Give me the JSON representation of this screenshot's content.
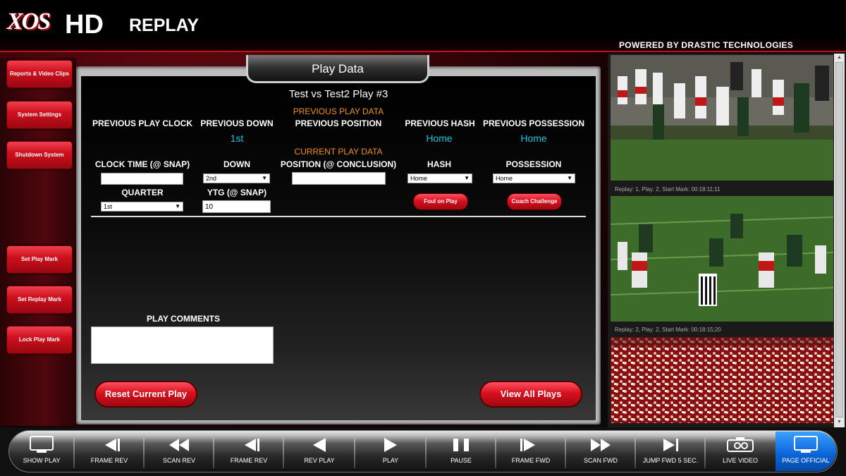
{
  "header": {
    "logo_xos": "XOS",
    "logo_hd": "HD",
    "logo_replay": "REPLAY",
    "powered_by": "POWERED  BY DRASTIC TECHNOLOGIES"
  },
  "sidebar": {
    "items": [
      {
        "label": "Reports & Video Clips"
      },
      {
        "label": "System Settings"
      },
      {
        "label": "Shutdown System"
      },
      {
        "label": "Set Play Mark"
      },
      {
        "label": "Set Replay Mark"
      },
      {
        "label": "Lock Play Mark"
      }
    ]
  },
  "panel": {
    "title": "Play Data",
    "game_title": "Test vs Test2 Play #3",
    "previous": {
      "section_label": "PREVIOUS PLAY DATA",
      "play_clock_label": "PREVIOUS PLAY CLOCK",
      "down_label": "PREVIOUS DOWN",
      "down_value": "1st",
      "position_label": "PREVIOUS POSITION",
      "hash_label": "PREVIOUS HASH",
      "hash_value": "Home",
      "possession_label": "PREVIOUS POSSESSION",
      "possession_value": "Home"
    },
    "current": {
      "section_label": "CURRENT PLAY DATA",
      "clock_time_label": "CLOCK TIME (@ SNAP)",
      "clock_time_value": "",
      "down_label": "DOWN",
      "down_value": "2nd",
      "position_label": "POSITION (@ CONCLUSION)",
      "position_value": "",
      "hash_label": "HASH",
      "hash_value": "Home",
      "possession_label": "POSSESSION",
      "possession_value": "Home",
      "quarter_label": "QUARTER",
      "quarter_value": "1st",
      "ytg_label": "YTG (@ SNAP)",
      "ytg_value": "10",
      "foul_button": "Foul on Play",
      "challenge_button": "Coach Challenge"
    },
    "comments_label": "PLAY COMMENTS",
    "comments_value": "",
    "reset_button": "Reset Current Play",
    "view_all_button": "View All Plays"
  },
  "videos": {
    "clips": [
      {
        "caption": "Replay: 1, Play: 2, Start Mark: 00:18:11;11"
      },
      {
        "caption": "Replay: 2, Play: 2, Start Mark: 00:18:15;20"
      },
      {
        "caption": ""
      }
    ]
  },
  "transport": {
    "buttons": [
      {
        "label": "SHOW PLAY",
        "icon": "monitor-icon"
      },
      {
        "label": "FRAME REV",
        "icon": "frame-rev-icon"
      },
      {
        "label": "SCAN REV",
        "icon": "scan-rev-icon"
      },
      {
        "label": "FRAME REV",
        "icon": "frame-rev-icon"
      },
      {
        "label": "REV PLAY",
        "icon": "rev-play-icon"
      },
      {
        "label": "PLAY",
        "icon": "play-icon"
      },
      {
        "label": "PAUSE",
        "icon": "pause-icon"
      },
      {
        "label": "FRAME FWD",
        "icon": "frame-fwd-icon"
      },
      {
        "label": "SCAN FWD",
        "icon": "scan-fwd-icon"
      },
      {
        "label": "JUMP FWD 5 SEC.",
        "icon": "jump-fwd-icon"
      },
      {
        "label": "LIVE VIDEO",
        "icon": "camera-icon"
      },
      {
        "label": "PAGE OFFICIAL",
        "icon": "monitor-icon"
      }
    ],
    "active_color": "#0a62d6"
  },
  "colors": {
    "accent_red": "#d0101e",
    "section_orange": "#f09020",
    "value_cyan": "#19c4e6"
  }
}
